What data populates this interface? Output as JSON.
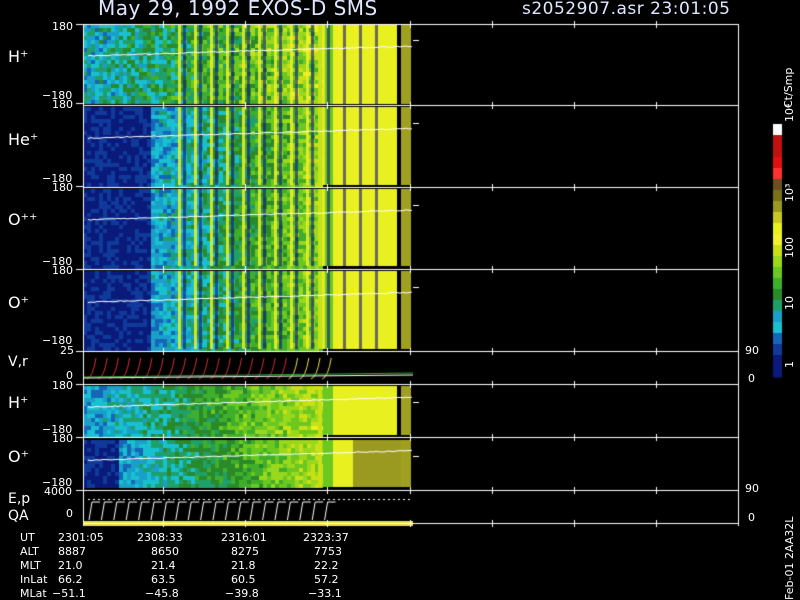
{
  "header": {
    "title": "May 29, 1992   EXOS-D SMS",
    "file_time": "s2052907.asr  23:01:05"
  },
  "colorbar": {
    "unit": "Ct/Smp",
    "tick_labels": [
      "10⁴",
      "10³",
      "100",
      "10",
      "1"
    ]
  },
  "footer": {
    "labels": [
      "UT",
      "ALT",
      "MLT",
      "InLat",
      "MLat"
    ],
    "columns": [
      [
        "2301:05",
        "8887",
        "21.0",
        "66.2",
        "−51.1"
      ],
      [
        "2308:33",
        "8650",
        "21.4",
        "63.5",
        "−45.8"
      ],
      [
        "2316:01",
        "8275",
        "21.8",
        "60.5",
        "−39.8"
      ],
      [
        "2323:37",
        "7753",
        "22.2",
        "57.2",
        "−33.1"
      ]
    ],
    "vertical_stamp": "Feb-01 2AA32L"
  },
  "chart_data": {
    "type": "heatmap",
    "title": "May 29, 1992   EXOS-D SMS",
    "panels": [
      {
        "label": "H⁺",
        "yticks": [
          "180",
          "−180"
        ]
      },
      {
        "label": "He⁺",
        "yticks": [
          "180",
          "−180"
        ]
      },
      {
        "label": "O⁺⁺",
        "yticks": [
          "180",
          "−180"
        ]
      },
      {
        "label": "O⁺",
        "yticks": [
          "180",
          "−180"
        ]
      },
      {
        "label": "V,r",
        "yticks": [
          "25",
          "0"
        ],
        "right_ticks": [
          "90",
          "0"
        ]
      },
      {
        "label": "H⁺",
        "yticks": [
          "180",
          "−180"
        ]
      },
      {
        "label": "O⁺",
        "yticks": [
          "180",
          "−180"
        ]
      },
      {
        "label": "E,p",
        "yticks": [
          "4000",
          "0"
        ],
        "right_ticks": [
          "90",
          "0"
        ]
      },
      {
        "label": "QA",
        "yticks": []
      }
    ],
    "x_ticks_ut": [
      "2301:05",
      "2308:33",
      "2316:01",
      "2323:37"
    ],
    "colorbar_scale": "log",
    "colorbar_range": [
      1,
      10000
    ],
    "grid": true
  }
}
